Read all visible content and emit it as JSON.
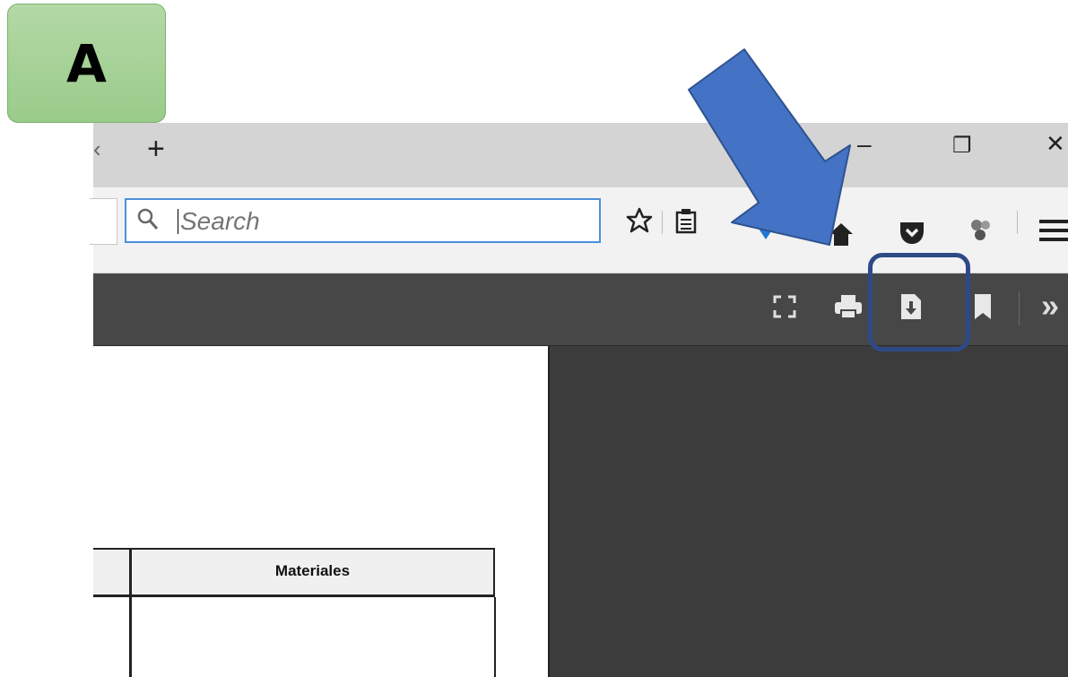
{
  "annotation": {
    "label": "A"
  },
  "window": {
    "new_tab": "+",
    "minimize": "–",
    "restore": "❐",
    "close": "✕"
  },
  "search": {
    "placeholder": "Search"
  },
  "pdf_table": {
    "header": "Materiales"
  },
  "colors": {
    "arrow": "#4472c4",
    "highlight_box": "#2e4a86",
    "pdf_toolbar": "#474747",
    "label_box": "#9acb8a",
    "search_focus": "#4a90d9"
  },
  "icons": [
    "search-icon",
    "bookmark-star-icon",
    "reading-list-icon",
    "pocket-icon",
    "home-icon",
    "extension-icon",
    "menu-icon",
    "fullscreen-icon",
    "print-icon",
    "download-icon",
    "bookmark-icon",
    "more-tools-icon",
    "callout-arrow"
  ]
}
